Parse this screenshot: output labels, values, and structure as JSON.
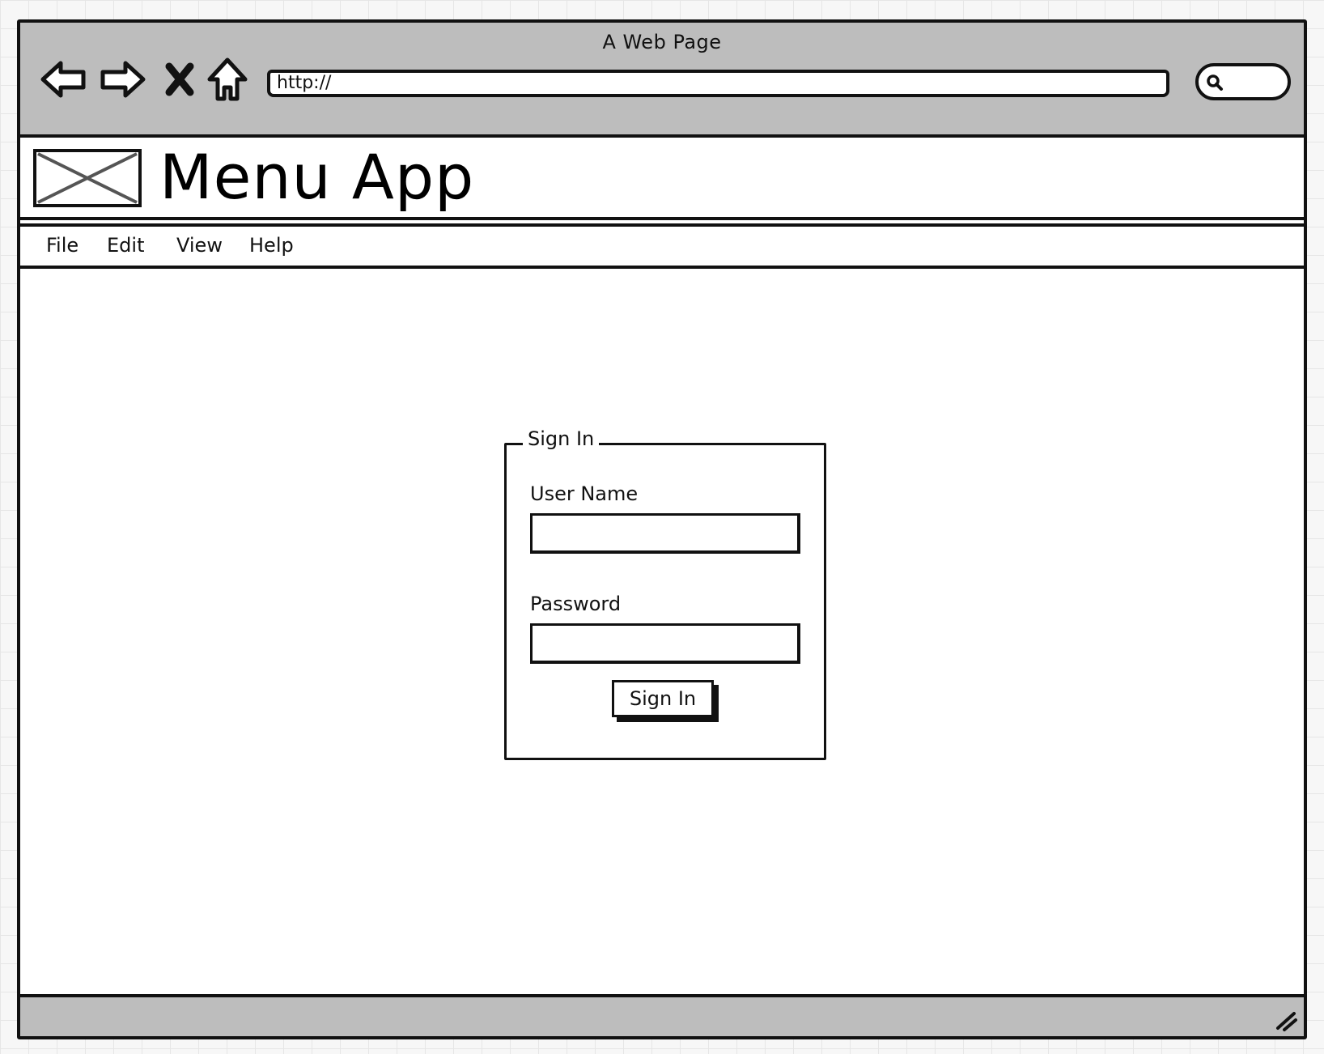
{
  "window": {
    "title": "A Web Page"
  },
  "toolbar": {
    "back_icon": "arrow-left-icon",
    "forward_icon": "arrow-right-icon",
    "stop_icon": "close-x-icon",
    "home_icon": "home-icon",
    "url_value": "http://",
    "search_icon": "search-icon"
  },
  "header": {
    "logo_icon": "image-placeholder-icon",
    "title": "Menu App"
  },
  "menu": {
    "items": [
      {
        "label": "File"
      },
      {
        "label": "Edit"
      },
      {
        "label": "View"
      },
      {
        "label": "Help"
      }
    ]
  },
  "signin": {
    "legend": "Sign In",
    "username_label": "User Name",
    "username_value": "",
    "password_label": "Password",
    "password_value": "",
    "submit_label": "Sign In"
  },
  "status_bar": {
    "resize_icon": "resize-grip-icon"
  },
  "colors": {
    "chrome_gray": "#bdbdbd",
    "stroke": "#111111",
    "page_background": "#ffffff",
    "grid_background": "#f7f7f7"
  }
}
